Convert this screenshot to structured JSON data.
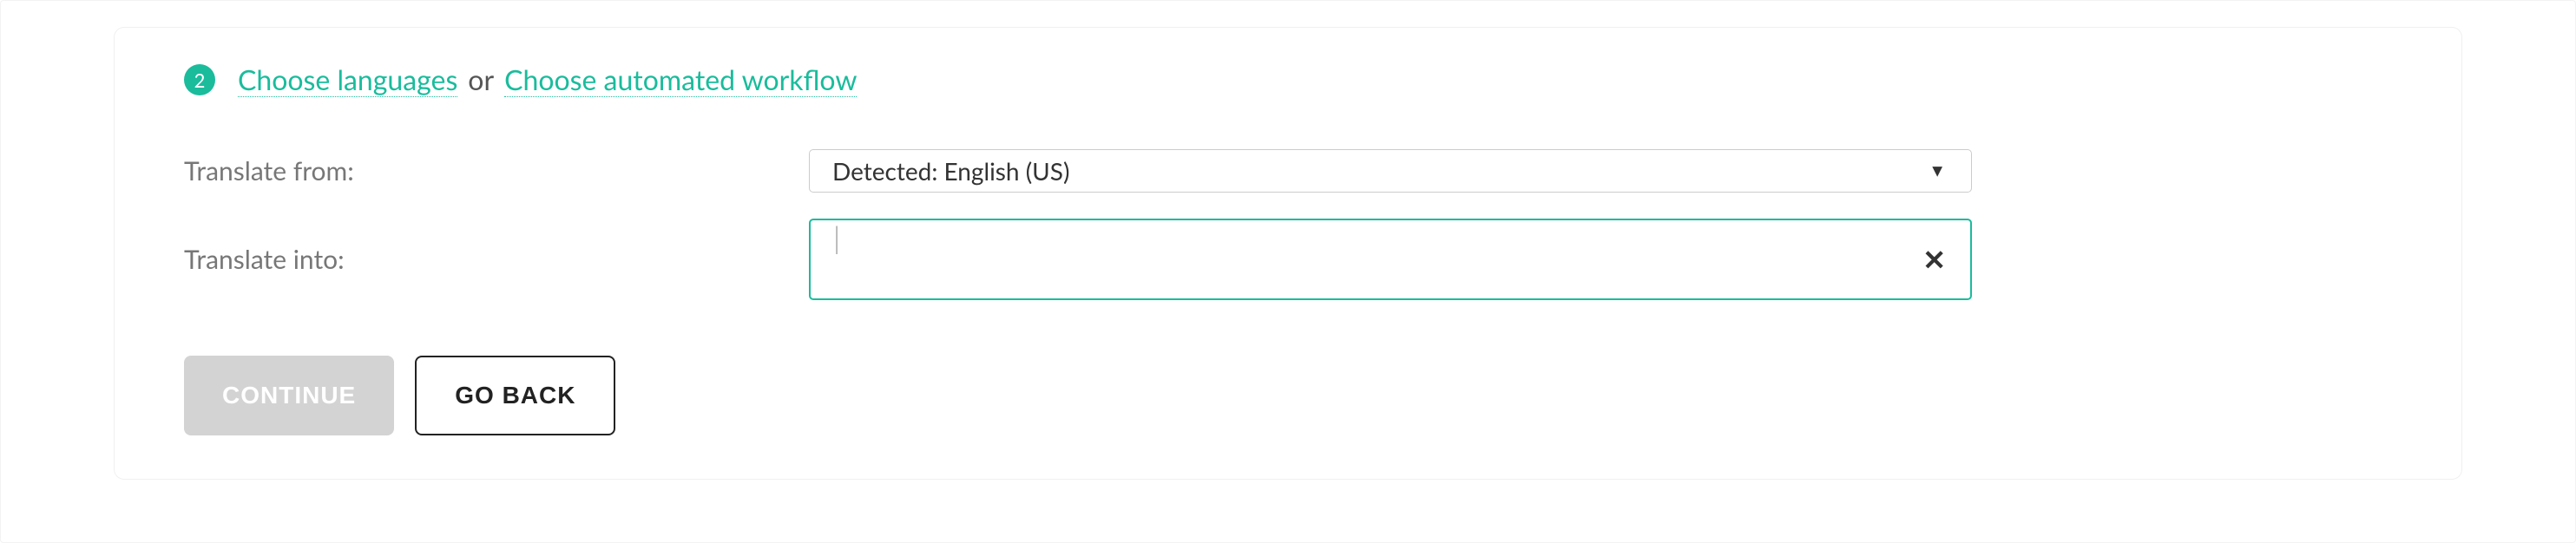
{
  "step": {
    "number": "2",
    "link_languages": "Choose languages",
    "or_text": "or",
    "link_workflow": "Choose automated workflow"
  },
  "form": {
    "from_label": "Translate from:",
    "from_value": "Detected: English (US)",
    "into_label": "Translate into:",
    "into_value": ""
  },
  "buttons": {
    "continue": "CONTINUE",
    "go_back": "GO BACK"
  }
}
